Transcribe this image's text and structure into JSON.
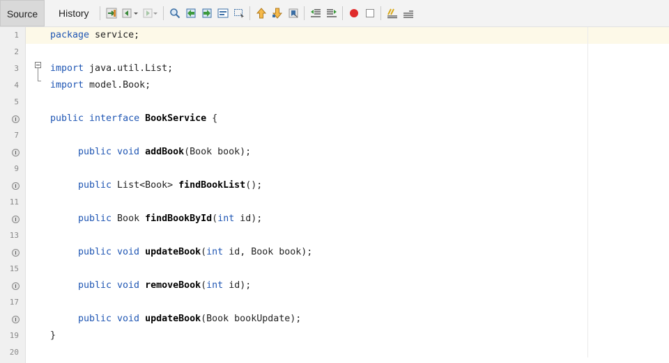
{
  "tabs": {
    "source": "Source",
    "history": "History"
  },
  "toolbar_icons": [
    "go-to-last-edit-icon",
    "back-icon",
    "forward-icon",
    "find-selection-icon",
    "find-previous-icon",
    "find-next-icon",
    "toggle-highlight-search-icon",
    "toggle-rectangular-selection-icon",
    "previous-bookmark-icon",
    "next-bookmark-icon",
    "toggle-bookmark-icon",
    "shift-left-icon",
    "shift-right-icon",
    "start-macro-recording-icon",
    "stop-macro-recording-icon",
    "comment-icon",
    "uncomment-icon"
  ],
  "line_numbers": [
    "1",
    "2",
    "3",
    "4",
    "5",
    "",
    "7",
    "",
    "9",
    "",
    "11",
    "",
    "13",
    "",
    "15",
    "",
    "17",
    "",
    "19",
    "20"
  ],
  "code": {
    "l1": {
      "kw": "package",
      "rest": " service;"
    },
    "l3": {
      "kw": "import",
      "rest": " java.util.List;"
    },
    "l4": {
      "kw": "import",
      "rest": " model.Book;"
    },
    "l6": {
      "kw": "public interface",
      "sp": " ",
      "name": "BookService",
      "rest": " {"
    },
    "l8": {
      "kw": "public void",
      "sp": " ",
      "name": "addBook",
      "rest": "(Book book);"
    },
    "l10": {
      "kw": "public",
      "pre": " List<Book> ",
      "name": "findBookList",
      "rest": "();"
    },
    "l12": {
      "kw": "public",
      "pre": " Book ",
      "name": "findBookById",
      "p1": "(",
      "kw2": "int",
      "rest": " id);"
    },
    "l14": {
      "kw": "public void",
      "sp": " ",
      "name": "updateBook",
      "p1": "(",
      "kw2": "int",
      "rest": " id, Book book);"
    },
    "l16": {
      "kw": "public void",
      "sp": " ",
      "name": "removeBook",
      "p1": "(",
      "kw2": "int",
      "rest": " id);"
    },
    "l18": {
      "kw": "public void",
      "sp": " ",
      "name": "updateBook",
      "rest": "(Book bookUpdate);"
    },
    "l19": {
      "rest": "}"
    }
  },
  "colors": {
    "keyword": "#1e55b3",
    "current_line": "#fdf9e8",
    "gutter": "#f0f0f0"
  }
}
